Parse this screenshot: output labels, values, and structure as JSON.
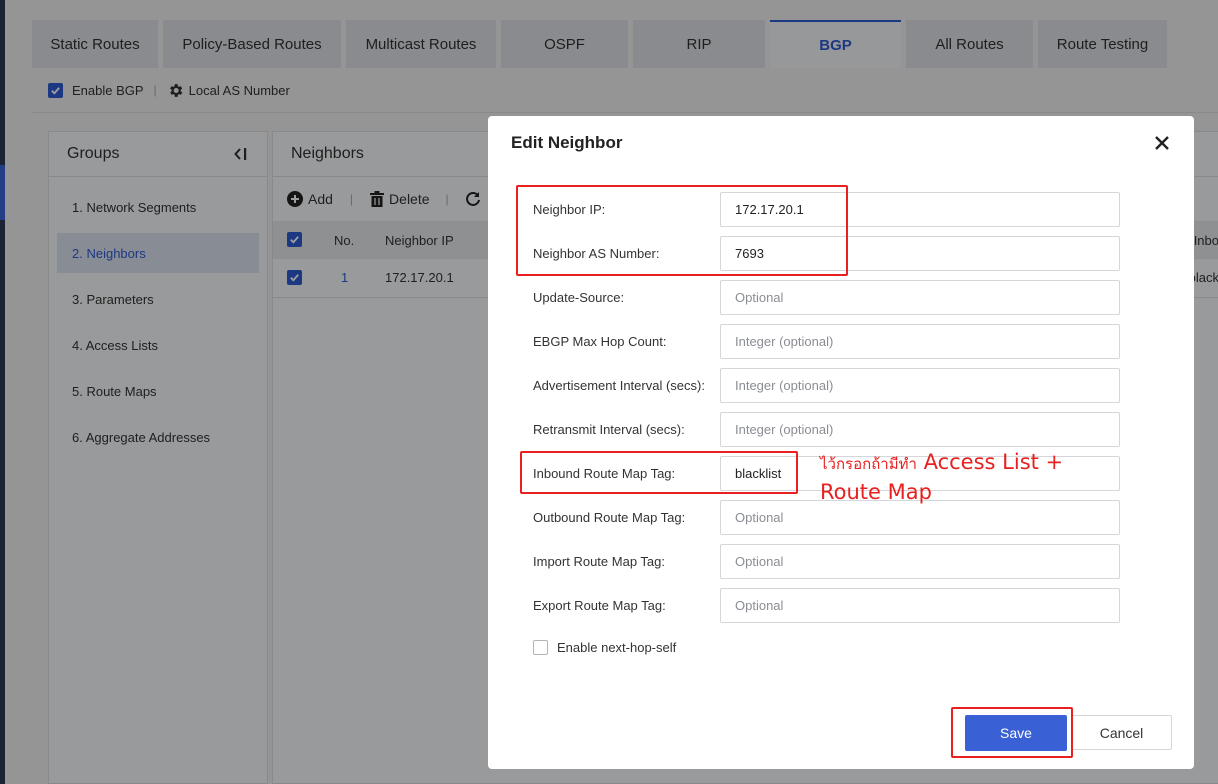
{
  "tabs": [
    "Static Routes",
    "Policy-Based Routes",
    "Multicast Routes",
    "OSPF",
    "RIP",
    "BGP",
    "All Routes",
    "Route Testing"
  ],
  "toolbar": {
    "enable_bgp": "Enable BGP",
    "local_as": "Local AS Number"
  },
  "groups": {
    "title": "Groups",
    "items": [
      "1. Network Segments",
      "2. Neighbors",
      "3. Parameters",
      "4. Access Lists",
      "5. Route Maps",
      "6. Aggregate Addresses"
    ]
  },
  "neighbors": {
    "title": "Neighbors",
    "add": "Add",
    "delete": "Delete",
    "columns": {
      "no": "No.",
      "ip": "Neighbor IP",
      "inbound": "Inbo"
    },
    "row": {
      "no": "1",
      "ip": "172.17.20.1",
      "inbound": "olack"
    }
  },
  "modal": {
    "title": "Edit Neighbor",
    "fields": {
      "neighbor_ip": {
        "label": "Neighbor IP:",
        "value": "172.17.20.1"
      },
      "as_number": {
        "label": "Neighbor AS Number:",
        "value": "7693"
      },
      "update_source": {
        "label": "Update-Source:",
        "placeholder": "Optional"
      },
      "ebgp_hop": {
        "label": "EBGP Max Hop Count:",
        "placeholder": "Integer (optional)"
      },
      "adv_interval": {
        "label": "Advertisement Interval (secs):",
        "placeholder": "Integer (optional)"
      },
      "retransmit": {
        "label": "Retransmit Interval (secs):",
        "placeholder": "Integer (optional)"
      },
      "inbound_map": {
        "label": "Inbound Route Map Tag:",
        "value": "blacklist"
      },
      "outbound_map": {
        "label": "Outbound Route Map Tag:",
        "placeholder": "Optional"
      },
      "import_map": {
        "label": "Import Route Map Tag:",
        "placeholder": "Optional"
      },
      "export_map": {
        "label": "Export Route Map Tag:",
        "placeholder": "Optional"
      }
    },
    "next_hop_self": "Enable next-hop-self",
    "save": "Save",
    "cancel": "Cancel"
  },
  "annotation": {
    "line1_thai": "ไว้กรอกถ้ามีทำ",
    "line1_en": "Access List +",
    "line2": "Route Map"
  },
  "colors": {
    "accent": "#2f5bd3",
    "save": "#3960d4",
    "annotation": "#e8201f"
  }
}
